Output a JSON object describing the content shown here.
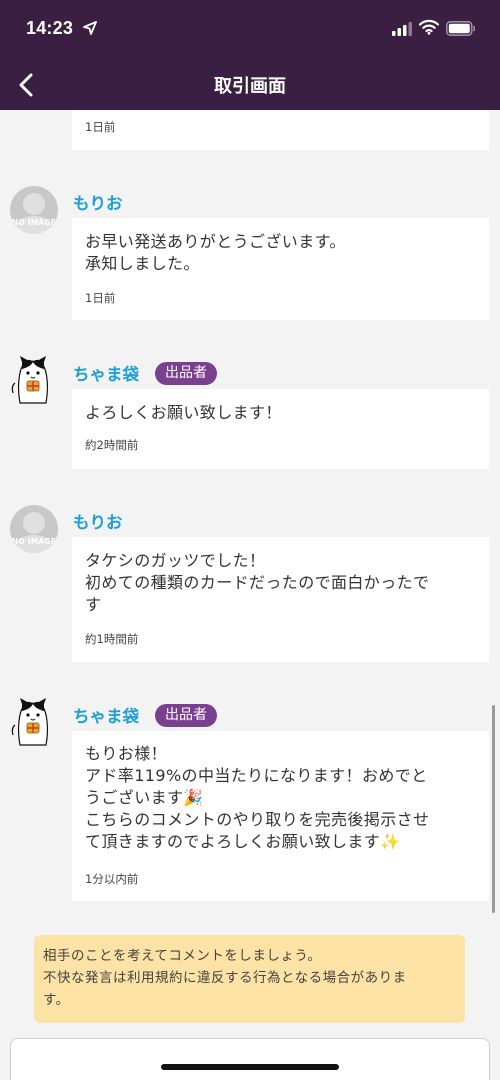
{
  "status_bar": {
    "time": "14:23",
    "icons": [
      "location-arrow-icon",
      "cellular-signal-icon",
      "wifi-icon",
      "battery-icon"
    ]
  },
  "header": {
    "title": "取引画面",
    "back_icon": "chevron-left-icon"
  },
  "messages": [
    {
      "user": "",
      "avatar": "partial-previous-message",
      "text": "",
      "time": "1日前"
    },
    {
      "user": "もりお",
      "avatar_label": "NO IMAGE",
      "text": "お早い発送ありがとうございます。\n承知しました。",
      "time": "1日前"
    },
    {
      "user": "ちゃま袋",
      "badge": "出品者",
      "avatar": "cat-avatar",
      "text": "よろしくお願い致します！",
      "time": "約2時間前"
    },
    {
      "user": "もりお",
      "avatar_label": "NO IMAGE",
      "text": "タケシのガッツでした！\n初めての種類のカードだったので面白かったで\nす",
      "time": "約1時間前"
    },
    {
      "user": "ちゃま袋",
      "badge": "出品者",
      "avatar": "cat-avatar",
      "text": "もりお様！\nアド率119%の中当たりになります！おめでと\nうございます🎉\nこちらのコメントのやり取りを完売後掲示させ\nて頂きますのでよろしくお願い致します✨",
      "time": "1分以内前"
    }
  ],
  "notice": {
    "text": "相手のことを考えてコメントをしましょう。\n不快な発言は利用規約に違反する行為となる場合がありま\nす。"
  },
  "colors": {
    "header_bg": "#3b1f42",
    "username": "#1a9fd6",
    "badge_bg": "#7a3f8f",
    "notice_bg": "#fde2a6",
    "page_bg": "#f3f3f3"
  }
}
